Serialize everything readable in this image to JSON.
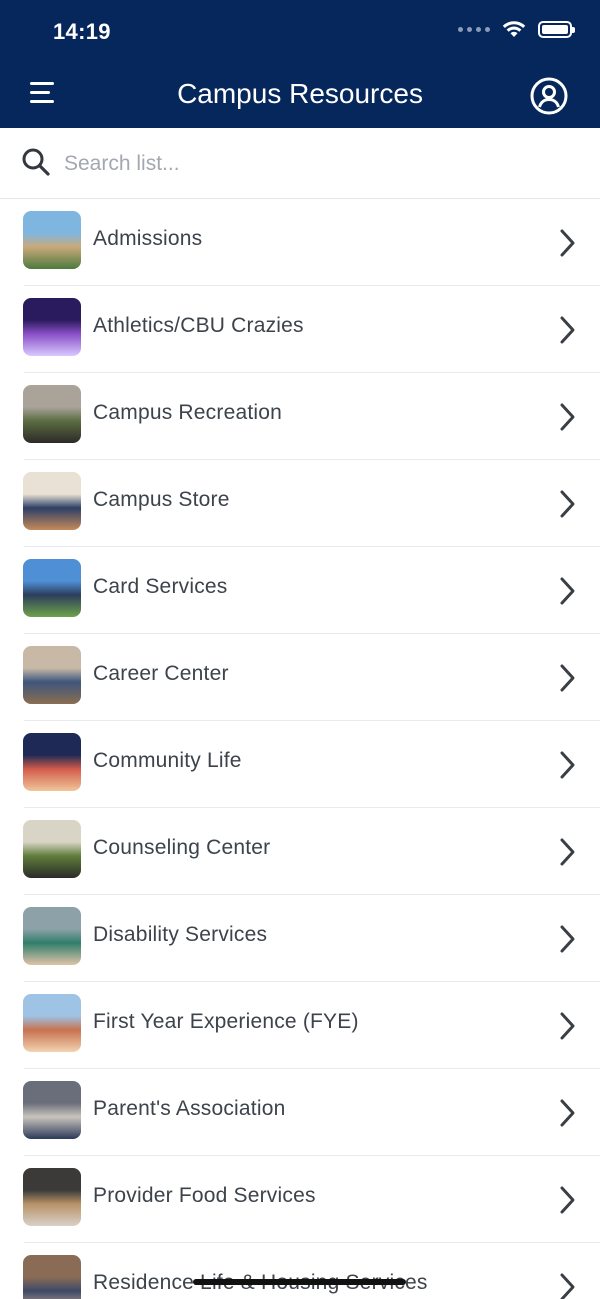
{
  "status_bar": {
    "time": "14:19"
  },
  "header": {
    "title": "Campus Resources"
  },
  "search": {
    "placeholder": "Search list..."
  },
  "list": {
    "items": [
      {
        "label": "Admissions",
        "colors": [
          "#7fb6e0",
          "#c9a97a",
          "#4c7a3c"
        ]
      },
      {
        "label": "Athletics/CBU Crazies",
        "colors": [
          "#2a1a5e",
          "#8a4fc7",
          "#d9c9ff"
        ]
      },
      {
        "label": "Campus Recreation",
        "colors": [
          "#a9a39a",
          "#5b6d42",
          "#2d2a28"
        ]
      },
      {
        "label": "Campus Store",
        "colors": [
          "#e9e2d4",
          "#2d3f66",
          "#c58a5a"
        ]
      },
      {
        "label": "Card Services",
        "colors": [
          "#4f8fd6",
          "#2c3e5c",
          "#6fa24a"
        ]
      },
      {
        "label": "Career Center",
        "colors": [
          "#c7b9a6",
          "#3e567c",
          "#8a6e52"
        ]
      },
      {
        "label": "Community Life",
        "colors": [
          "#1e2a55",
          "#d25b4b",
          "#f0c69a"
        ]
      },
      {
        "label": "Counseling Center",
        "colors": [
          "#d8d4c6",
          "#5f7d3a",
          "#2b2b2b"
        ]
      },
      {
        "label": "Disability Services",
        "colors": [
          "#8da1a8",
          "#2f7e6c",
          "#e0c3a8"
        ]
      },
      {
        "label": "First Year Experience (FYE)",
        "colors": [
          "#9ec3e4",
          "#c8714f",
          "#f2d3b1"
        ]
      },
      {
        "label": "Parent's Association",
        "colors": [
          "#6a6e7a",
          "#c9c4bc",
          "#2c3a5a"
        ]
      },
      {
        "label": "Provider Food Services",
        "colors": [
          "#3b3a38",
          "#b89268",
          "#d8d2c8"
        ]
      },
      {
        "label": "Residence Life & Housing Services",
        "colors": [
          "#8a6b55",
          "#3d4966",
          "#d6b39a"
        ]
      }
    ]
  },
  "colors": {
    "header_bg": "#06275c",
    "text": "#3d434b",
    "divider": "#e8eaed"
  }
}
